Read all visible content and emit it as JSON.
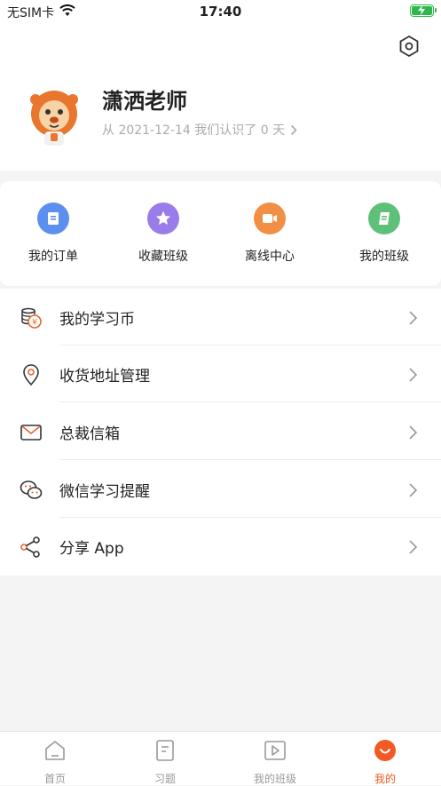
{
  "status_bar": {
    "carrier": "无SIM卡",
    "time": "17:40"
  },
  "profile": {
    "name": "潇洒老师",
    "since_text": "从 2021-12-14 我们认识了 0 天"
  },
  "quick_actions": [
    {
      "label": "我的订单",
      "color": "#5b8ff0",
      "icon": "book-icon"
    },
    {
      "label": "收藏班级",
      "color": "#9a7bea",
      "icon": "star-icon"
    },
    {
      "label": "离线中心",
      "color": "#f08f45",
      "icon": "video-icon"
    },
    {
      "label": "我的班级",
      "color": "#5fc07a",
      "icon": "notebook-icon"
    }
  ],
  "menu": [
    {
      "label": "我的学习币",
      "icon": "coins-icon"
    },
    {
      "label": "收货地址管理",
      "icon": "location-icon"
    },
    {
      "label": "总裁信箱",
      "icon": "mail-icon"
    },
    {
      "label": "微信学习提醒",
      "icon": "wechat-icon"
    },
    {
      "label": "分享 App",
      "icon": "share-icon"
    }
  ],
  "tabs": [
    {
      "label": "首页",
      "icon": "home-icon"
    },
    {
      "label": "习题",
      "icon": "exercise-icon"
    },
    {
      "label": "我的班级",
      "icon": "play-icon"
    },
    {
      "label": "我的",
      "icon": "smile-icon"
    }
  ],
  "colors": {
    "accent": "#f15a22",
    "icon_orange": "#e8612c"
  }
}
